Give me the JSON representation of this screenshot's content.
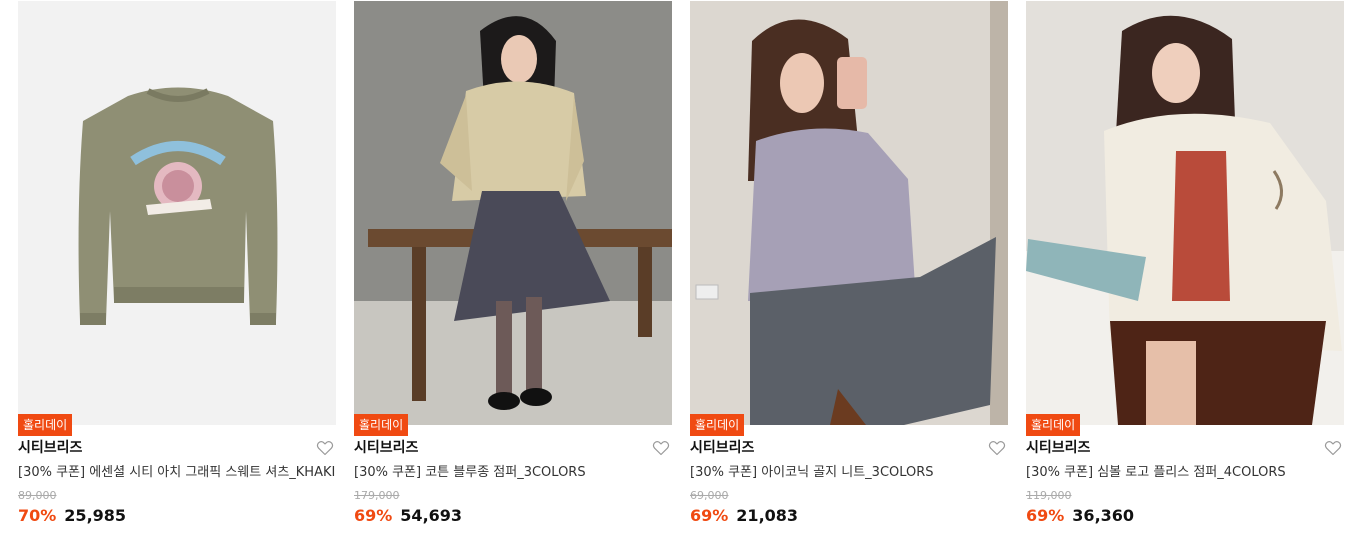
{
  "products": [
    {
      "badge": "홀리데이",
      "brand": "시티브리즈",
      "name": "[30% 쿠폰] 에센셜 시티 아치 그래픽 스웨트 셔츠_KHAKI",
      "original_price": "89,000",
      "discount": "70%",
      "price": "25,985",
      "image": "khaki-sweatshirt-with-citybreeze-logo",
      "wishlist_icon": "heart-outline-icon"
    },
    {
      "badge": "홀리데이",
      "brand": "시티브리즈",
      "name": "[30% 쿠폰] 코튼 블루종 점퍼_3COLORS",
      "original_price": "179,000",
      "discount": "69%",
      "price": "54,693",
      "image": "model-in-beige-blouson-on-bench",
      "wishlist_icon": "heart-outline-icon"
    },
    {
      "badge": "홀리데이",
      "brand": "시티브리즈",
      "name": "[30% 쿠폰] 아이코닉 골지 니트_3COLORS",
      "original_price": "69,000",
      "discount": "69%",
      "price": "21,083",
      "image": "model-in-lavender-knit-mirror-selfie",
      "wishlist_icon": "heart-outline-icon"
    },
    {
      "badge": "홀리데이",
      "brand": "시티브리즈",
      "name": "[30% 쿠폰] 심볼 로고 플리스 점퍼_4COLORS",
      "original_price": "119,000",
      "discount": "69%",
      "price": "36,360",
      "image": "model-in-cream-fleece-reading-book",
      "wishlist_icon": "heart-outline-icon"
    }
  ],
  "colors": {
    "badge_bg": "#f04a12",
    "discount": "#f04a12",
    "strike_price": "#aaaaaa"
  }
}
